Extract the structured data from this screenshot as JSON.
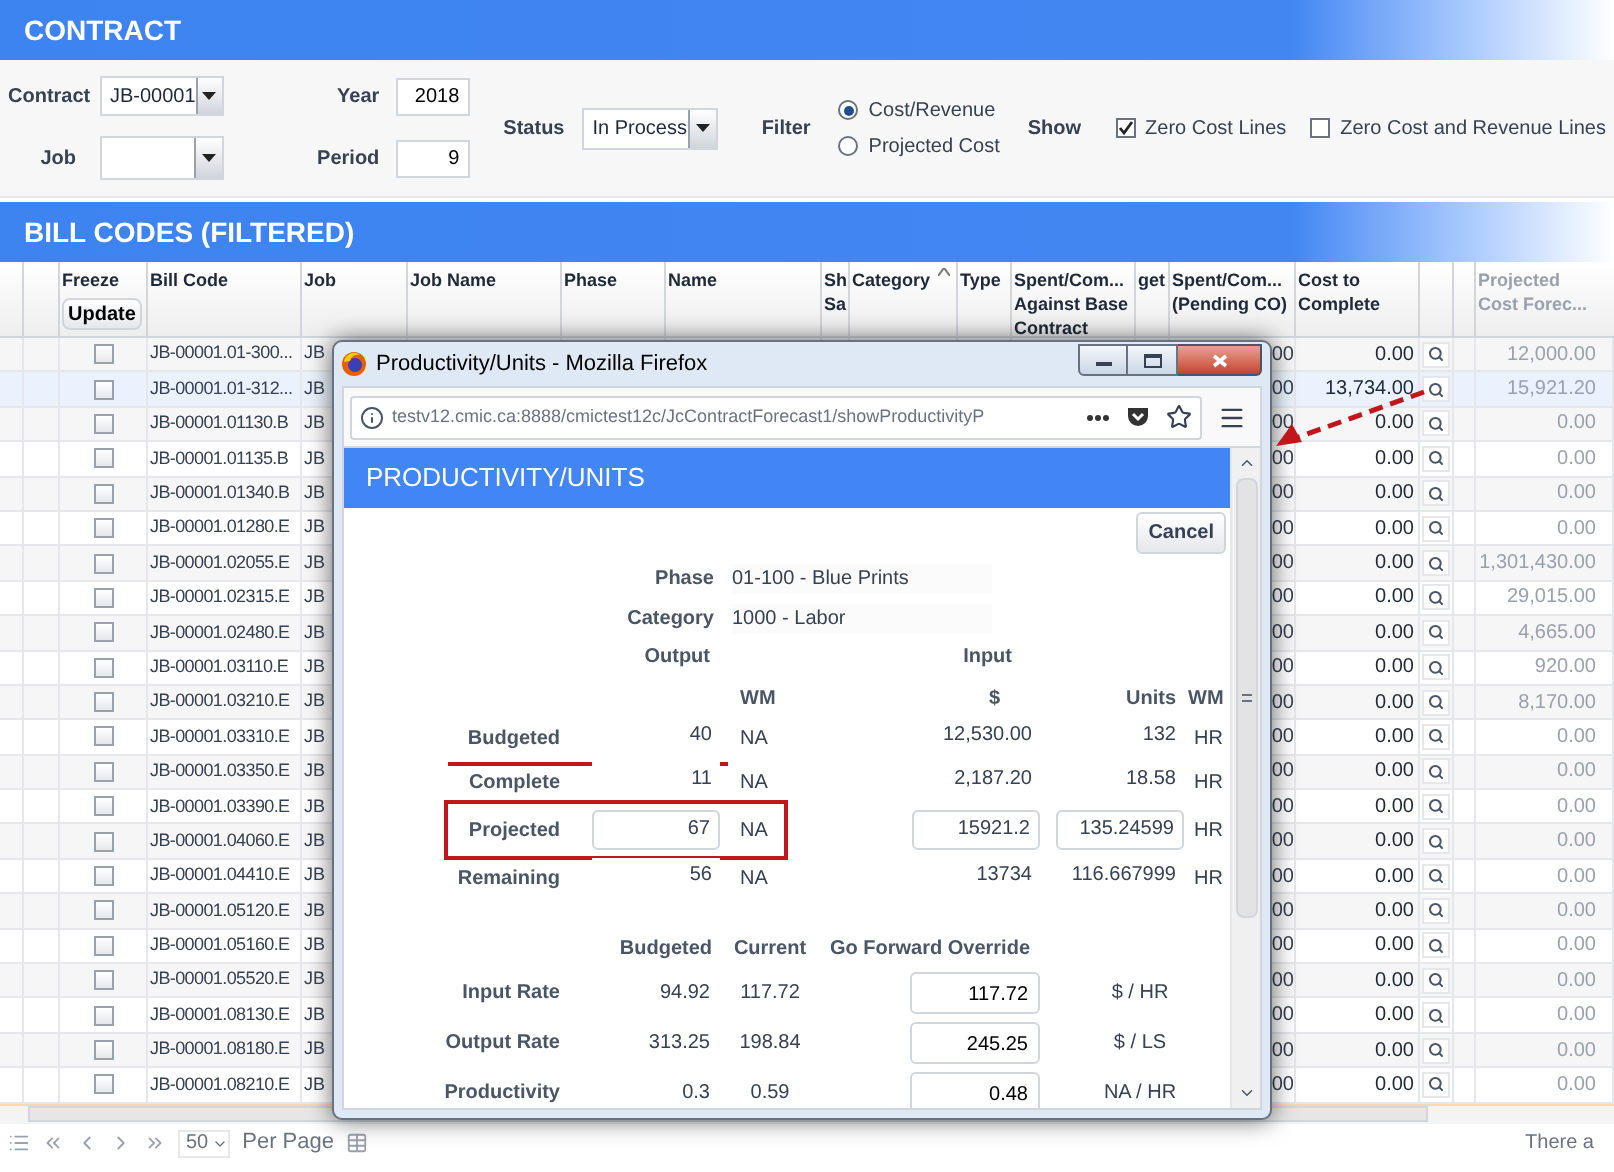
{
  "contract_panel": {
    "title": "CONTRACT",
    "contract": {
      "label": "Contract",
      "value": "JB-00001"
    },
    "job": {
      "label": "Job"
    },
    "year": {
      "label": "Year",
      "value": "2018"
    },
    "period": {
      "label": "Period",
      "value": "9"
    },
    "status": {
      "label": "Status",
      "value": "In Process"
    },
    "filter": {
      "label": "Filter",
      "options": [
        {
          "label": "Cost/Revenue",
          "selected": true
        },
        {
          "label": "Projected Cost",
          "selected": false
        }
      ]
    },
    "show": {
      "label": "Show",
      "options": [
        {
          "label": "Zero Cost Lines",
          "checked": true
        },
        {
          "label": "Zero Cost and Revenue Lines",
          "checked": false
        }
      ]
    }
  },
  "bill_codes": {
    "title": "BILL CODES (FILTERED)",
    "columns": [
      {
        "lines": [
          "Freeze"
        ],
        "button": "Update"
      },
      {
        "lines": [
          "Bill Code"
        ]
      },
      {
        "lines": [
          "Job"
        ]
      },
      {
        "lines": [
          "Job Name"
        ]
      },
      {
        "lines": [
          "Phase"
        ]
      },
      {
        "lines": [
          "Name"
        ]
      },
      {
        "lines": [
          "Sh",
          "Sa"
        ]
      },
      {
        "lines": [
          "Category"
        ],
        "sorted": true
      },
      {
        "lines": [
          "Type"
        ]
      },
      {
        "lines": [
          "Spent/Com...",
          "Against Base",
          "Contract"
        ]
      },
      {
        "lines": [
          "get"
        ]
      },
      {
        "lines": [
          "Spent/Com...",
          "(Pending CO)"
        ]
      },
      {
        "lines": [
          "Cost to",
          "Complete"
        ]
      },
      {
        "lines": [
          "Projected",
          "Cost Forec..."
        ]
      }
    ],
    "rows": [
      {
        "frozen": false,
        "selected": false,
        "bill_code": "JB-00001.01-300...",
        "job": "JB",
        "pending_co": "00",
        "cost_to_complete": "0.00",
        "projected": "12,000.00"
      },
      {
        "frozen": false,
        "selected": true,
        "bill_code": "JB-00001.01-312...",
        "job": "JB",
        "pending_co": "00",
        "cost_to_complete": "13,734.00",
        "projected": "15,921.20"
      },
      {
        "frozen": false,
        "selected": false,
        "bill_code": "JB-00001.01130.B",
        "job": "JB",
        "pending_co": "00",
        "cost_to_complete": "0.00",
        "projected": "0.00"
      },
      {
        "frozen": false,
        "selected": false,
        "bill_code": "JB-00001.01135.B",
        "job": "JB",
        "pending_co": "00",
        "cost_to_complete": "0.00",
        "projected": "0.00"
      },
      {
        "frozen": false,
        "selected": false,
        "bill_code": "JB-00001.01340.B",
        "job": "JB",
        "pending_co": "00",
        "cost_to_complete": "0.00",
        "projected": "0.00"
      },
      {
        "frozen": false,
        "selected": false,
        "bill_code": "JB-00001.01280.E",
        "job": "JB",
        "pending_co": "00",
        "cost_to_complete": "0.00",
        "projected": "0.00"
      },
      {
        "frozen": false,
        "selected": false,
        "bill_code": "JB-00001.02055.E",
        "job": "JB",
        "pending_co": "00",
        "cost_to_complete": "0.00",
        "projected": "1,301,430.00"
      },
      {
        "frozen": false,
        "selected": false,
        "bill_code": "JB-00001.02315.E",
        "job": "JB",
        "pending_co": "00",
        "cost_to_complete": "0.00",
        "projected": "29,015.00"
      },
      {
        "frozen": false,
        "selected": false,
        "bill_code": "JB-00001.02480.E",
        "job": "JB",
        "pending_co": "00",
        "cost_to_complete": "0.00",
        "projected": "4,665.00"
      },
      {
        "frozen": false,
        "selected": false,
        "bill_code": "JB-00001.03110.E",
        "job": "JB",
        "pending_co": "00",
        "cost_to_complete": "0.00",
        "projected": "920.00"
      },
      {
        "frozen": false,
        "selected": false,
        "bill_code": "JB-00001.03210.E",
        "job": "JB",
        "pending_co": "00",
        "cost_to_complete": "0.00",
        "projected": "8,170.00"
      },
      {
        "frozen": false,
        "selected": false,
        "bill_code": "JB-00001.03310.E",
        "job": "JB",
        "pending_co": "00",
        "cost_to_complete": "0.00",
        "projected": "0.00"
      },
      {
        "frozen": false,
        "selected": false,
        "bill_code": "JB-00001.03350.E",
        "job": "JB",
        "pending_co": "00",
        "cost_to_complete": "0.00",
        "projected": "0.00"
      },
      {
        "frozen": false,
        "selected": false,
        "bill_code": "JB-00001.03390.E",
        "job": "JB",
        "pending_co": "00",
        "cost_to_complete": "0.00",
        "projected": "0.00"
      },
      {
        "frozen": false,
        "selected": false,
        "bill_code": "JB-00001.04060.E",
        "job": "JB",
        "pending_co": "00",
        "cost_to_complete": "0.00",
        "projected": "0.00"
      },
      {
        "frozen": false,
        "selected": false,
        "bill_code": "JB-00001.04410.E",
        "job": "JB",
        "pending_co": "00",
        "cost_to_complete": "0.00",
        "projected": "0.00"
      },
      {
        "frozen": false,
        "selected": false,
        "bill_code": "JB-00001.05120.E",
        "job": "JB",
        "pending_co": "00",
        "cost_to_complete": "0.00",
        "projected": "0.00"
      },
      {
        "frozen": false,
        "selected": false,
        "bill_code": "JB-00001.05160.E",
        "job": "JB",
        "pending_co": "00",
        "cost_to_complete": "0.00",
        "projected": "0.00"
      },
      {
        "frozen": false,
        "selected": false,
        "bill_code": "JB-00001.05520.E",
        "job": "JB",
        "pending_co": "00",
        "cost_to_complete": "0.00",
        "projected": "0.00"
      },
      {
        "frozen": false,
        "selected": false,
        "bill_code": "JB-00001.08130.E",
        "job": "JB",
        "pending_co": "00",
        "cost_to_complete": "0.00",
        "projected": "0.00"
      },
      {
        "frozen": false,
        "selected": false,
        "bill_code": "JB-00001.08180.E",
        "job": "JB",
        "pending_co": "00",
        "cost_to_complete": "0.00",
        "projected": "0.00"
      },
      {
        "frozen": false,
        "selected": false,
        "bill_code": "JB-00001.08210.E",
        "job": "JB",
        "pending_co": "00",
        "cost_to_complete": "0.00",
        "projected": "0.00"
      }
    ],
    "pager": {
      "page_size": "50",
      "per_page": "Per Page",
      "status": "There a"
    }
  },
  "popup": {
    "window_title": "Productivity/Units - Mozilla Firefox",
    "url": "testv12.cmic.ca:8888/cmictest12c/JcContractForecast1/showProductivityP",
    "header": "PRODUCTIVITY/UNITS",
    "cancel": "Cancel",
    "fields": [
      {
        "label": "Phase",
        "value": "01-100 - Blue Prints"
      },
      {
        "label": "Category",
        "value": "1000 - Labor"
      }
    ],
    "output_heading": "Output",
    "input_heading": "Input",
    "unit_headers": [
      "WM",
      "$",
      "Units",
      "WM"
    ],
    "quantity_rows": [
      {
        "label": "Budgeted",
        "kind": "text",
        "output": "40",
        "output_wm": "NA",
        "amount": "12,530.00",
        "units": "132",
        "units_wm": "HR"
      },
      {
        "label": "Complete",
        "kind": "text",
        "output": "11",
        "output_wm": "NA",
        "amount": "2,187.20",
        "units": "18.58",
        "units_wm": "HR"
      },
      {
        "label": "Projected",
        "kind": "input",
        "output": "67",
        "output_wm": "NA",
        "amount": "15921.2",
        "units": "135.24599",
        "units_wm": "HR"
      },
      {
        "label": "Remaining",
        "kind": "text",
        "output": "56",
        "output_wm": "NA",
        "amount": "13734",
        "units": "116.667999",
        "units_wm": "HR"
      }
    ],
    "rate_headers": [
      "Budgeted",
      "Current",
      "Go Forward Override"
    ],
    "rate_rows": [
      {
        "label": "Input Rate",
        "budgeted": "94.92",
        "current": "117.72",
        "override": "117.72",
        "unit": "$ / HR"
      },
      {
        "label": "Output Rate",
        "budgeted": "313.25",
        "current": "198.84",
        "override": "245.25",
        "unit": "$ / LS"
      },
      {
        "label": "Productivity",
        "budgeted": "0.3",
        "current": "0.59",
        "override": "0.48",
        "unit": "NA / HR"
      }
    ]
  }
}
